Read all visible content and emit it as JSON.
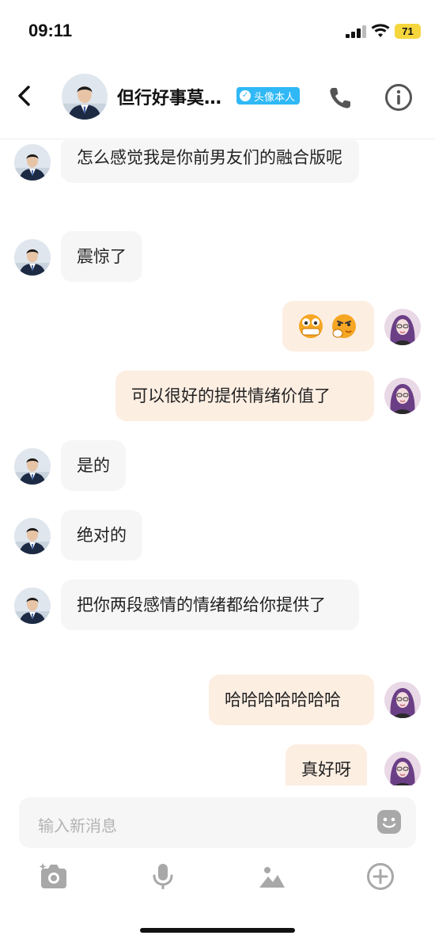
{
  "status_bar": {
    "time": "09:11",
    "battery": "71"
  },
  "header": {
    "contact_name": "但行好事莫…",
    "badge": "头像本人"
  },
  "messages": [
    {
      "side": "in",
      "text": "怎么感觉我是你前男友们的融合版呢"
    },
    {
      "side": "in",
      "text": "震惊了"
    },
    {
      "side": "out",
      "text": "emoji-stickers"
    },
    {
      "side": "out",
      "text": "可以很好的提供情绪价值了"
    },
    {
      "side": "in",
      "text": "是的"
    },
    {
      "side": "in",
      "text": "绝对的"
    },
    {
      "side": "in",
      "text": "把你两段感情的情绪都给你提供了"
    },
    {
      "side": "out",
      "text": "哈哈哈哈哈哈哈"
    },
    {
      "side": "out",
      "text": "真好呀"
    }
  ],
  "input": {
    "placeholder": "输入新消息"
  },
  "icons": {
    "back": "chevron-left-icon",
    "call": "phone-icon",
    "info": "info-icon",
    "emoji": "smiley-icon",
    "camera": "camera-icon",
    "voice": "microphone-icon",
    "image": "image-icon",
    "more": "plus-circle-icon"
  },
  "colors": {
    "incoming_bubble": "#f6f6f6",
    "outgoing_bubble": "#fdeee2",
    "badge": "#2fb8f5",
    "battery": "#f5d63d"
  }
}
